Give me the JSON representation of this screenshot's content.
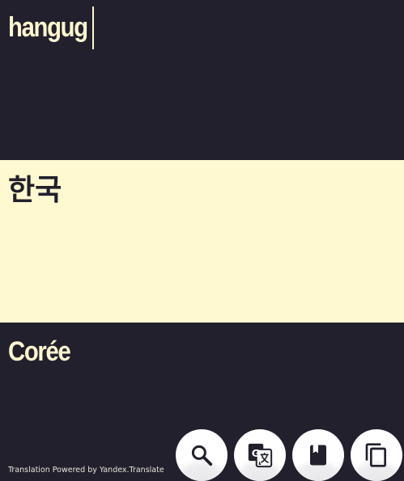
{
  "input": {
    "value": "hangug"
  },
  "result": {
    "primary": "한국",
    "secondary": "Corée"
  },
  "footer": {
    "credit": "Translation Powered by Yandex.Translate"
  },
  "actions": [
    {
      "icon": "search-icon"
    },
    {
      "icon": "google-translate-icon"
    },
    {
      "icon": "dictionary-icon"
    },
    {
      "icon": "copy-icon"
    }
  ],
  "colors": {
    "dark": "#22202c",
    "cream": "#fff9d1",
    "text_light": "#fff6cf"
  }
}
